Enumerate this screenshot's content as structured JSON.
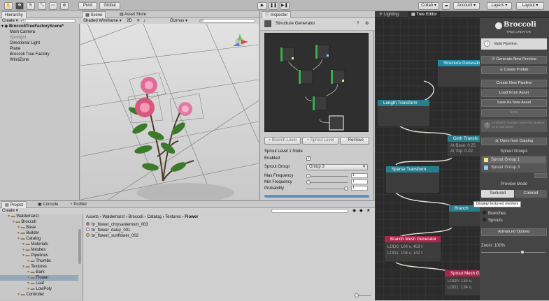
{
  "toolbar": {
    "pivot": "Pivot",
    "global": "Global",
    "collab": "Collab",
    "account": "Account",
    "layers": "Layers",
    "layout": "Layout"
  },
  "hierarchy": {
    "tab": "Hierarchy",
    "create": "Create",
    "search_placeholder": "All",
    "scene": "BroccoliTreeFactoryScene*",
    "items": [
      "Main Camera",
      "Spotlight",
      "Directional Light",
      "Plane",
      "Broccoli Tree Factory",
      "WindZone"
    ]
  },
  "scene": {
    "tab_scene": "Scene",
    "tab_asset_store": "Asset Store",
    "shading": "Shaded Wireframe",
    "mode2d": "2D",
    "gizmos": "Gizmos",
    "search_placeholder": "All"
  },
  "inspector": {
    "tab": "Inspector",
    "component": "Structure Generator",
    "add_branch": "+ Branch Level",
    "add_sprout": "+ Sprout Level",
    "remove": "- Remove",
    "section": "Sprout Level 1 Node",
    "fields": [
      {
        "label": "Enabled",
        "value": ""
      },
      {
        "label": "Sprout Group",
        "value": "Group 3"
      },
      {
        "label": "Max Frequency",
        "value": "1"
      },
      {
        "label": "Min Frequency",
        "value": "1"
      },
      {
        "label": "Probability",
        "value": "1"
      }
    ]
  },
  "project": {
    "tab_project": "Project",
    "tab_console": "Console",
    "tab_profiler": "Profiler",
    "create": "Create",
    "breadcrumb": [
      "Assets",
      "Waldemarst",
      "Broccoli",
      "Catalog",
      "Textures",
      "Flower"
    ],
    "tree": [
      {
        "label": "Waldemarst",
        "d": 1
      },
      {
        "label": "Broccoli",
        "d": 2
      },
      {
        "label": "Base",
        "d": 3
      },
      {
        "label": "Builder",
        "d": 3
      },
      {
        "label": "Catalog",
        "d": 3
      },
      {
        "label": "Materials",
        "d": 4
      },
      {
        "label": "Meshes",
        "d": 4
      },
      {
        "label": "Pipelines",
        "d": 4
      },
      {
        "label": "Thumbs",
        "d": 5
      },
      {
        "label": "Textures",
        "d": 4
      },
      {
        "label": "Bark",
        "d": 5
      },
      {
        "label": "Flower",
        "d": 5,
        "sel": true
      },
      {
        "label": "Leaf",
        "d": 5
      },
      {
        "label": "LowPoly",
        "d": 5
      },
      {
        "label": "Controller",
        "d": 3
      }
    ],
    "files": [
      {
        "name": "br_flower_chrysantemum_003",
        "color": "#e0567a"
      },
      {
        "name": "br_flower_daisy_001",
        "color": "#f2f2f2"
      },
      {
        "name": "br_flower_sunflower_002",
        "color": "#f2b61c"
      }
    ]
  },
  "editor": {
    "tab_lighting": "Lighting",
    "tab_tree_editor": "Tree Editor",
    "nodes": {
      "structure": "Structure Generator",
      "length": "Length Transform",
      "girth": "Girth Transfo",
      "girth_base": "At Base: 0.25",
      "girth_top": "At Top: 0.02",
      "sparse": "Sparse Transform",
      "branch": "Branch",
      "branch_mesh": "Branch Mesh Generator",
      "bm_lod0": "LOD0: 104 v, 459 t",
      "bm_lod1": "LOD1: 104 v, 142 t",
      "sprout_mesh": "Sprout Mesh G",
      "sm_lod0": "LOD0: 134 v,",
      "sm_lod1": "LOD1: 134 v,"
    }
  },
  "panel": {
    "logo": "Broccoli",
    "logo_sub": "TREE CREATOR",
    "valid": "Valid Pipeline.",
    "generate": "Generate New Preview",
    "prefab": "Create Prefab",
    "new_pipeline": "Create New Pipeline",
    "load": "Load From Asset",
    "save_as": "Save As New Asset",
    "save": "Save",
    "unsaved": "Unsaved changes, save this pipeline to a new asset.",
    "catalog": "Open from Catalog",
    "sprout_groups": "Sprout Groups",
    "groups": [
      {
        "name": "Sprout Group 1",
        "color": "#f0e87a"
      },
      {
        "name": "Sprout Group 3",
        "color": "#8fd0f0"
      }
    ],
    "preview_mode": "Preview Mode",
    "textured": "Textured",
    "colored": "Colored",
    "tooltip": "Display textured meshes",
    "branches": "Branches",
    "sprouts": "Sprouts",
    "advanced": "Advanced Options",
    "zoom": "Zoom: 100%"
  }
}
